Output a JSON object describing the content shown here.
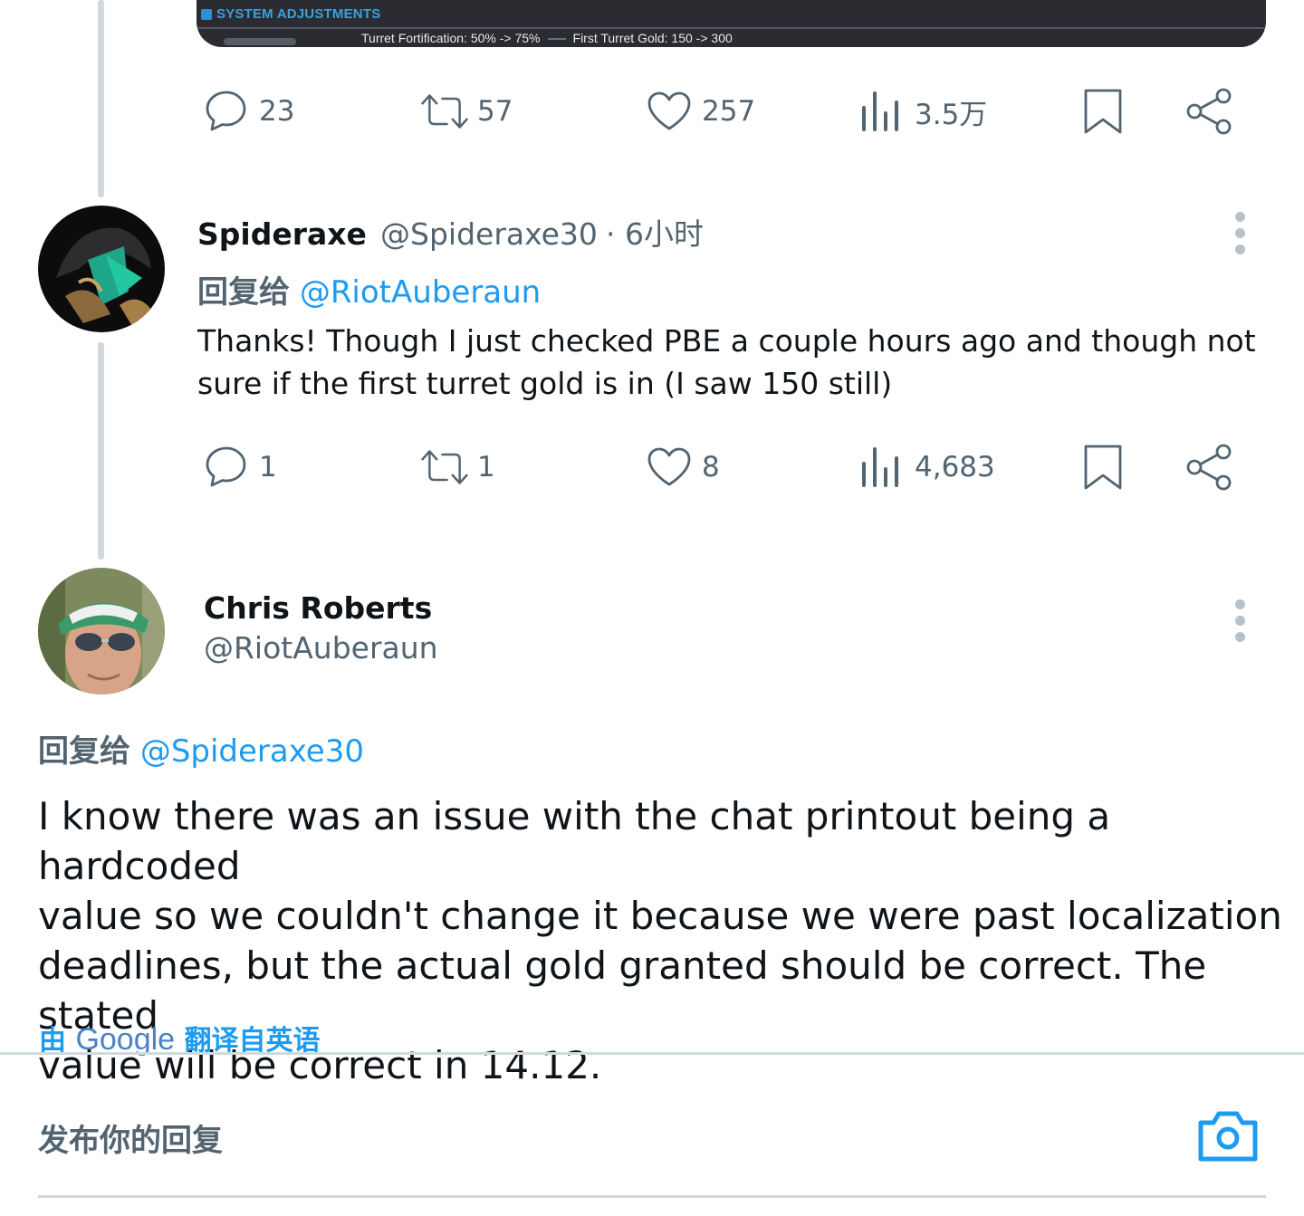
{
  "media": {
    "header": "SYSTEM ADJUSTMENTS",
    "line_a": "Turret Fortification: 50% -> 75%",
    "line_b": "First Turret Gold: 150 -> 300"
  },
  "tweet1_actions": {
    "replies": "23",
    "retweets": "57",
    "likes": "257",
    "views": "3.5万"
  },
  "reply1": {
    "name": "Spideraxe",
    "handle": "@Spideraxe30",
    "time": "· 6小时",
    "reply_prefix": "回复给",
    "reply_to": "@RiotAuberaun",
    "text_line1": "Thanks! Though I just checked PBE a couple hours ago and though not",
    "text_line2": "sure if the first turret gold is in (I saw 150 still)",
    "actions": {
      "replies": "1",
      "retweets": "1",
      "likes": "8",
      "views": "4,683"
    }
  },
  "main_tweet": {
    "name": "Chris Roberts",
    "handle": "@RiotAuberaun",
    "reply_prefix": "回复给",
    "reply_to": "@Spideraxe30",
    "text_line1": "I know there was an issue with the chat printout being a hardcoded",
    "text_line2": "value so we couldn't change it because we were past localization",
    "text_line3": "deadlines, but the actual gold granted should be correct. The stated",
    "text_line4": "value will be correct in 14.12.",
    "translate_prefix": "由",
    "translate_brand": "Google",
    "translate_suffix": "翻译自英语"
  },
  "composer": {
    "placeholder": "发布你的回复"
  },
  "colors": {
    "accent": "#1d9bf0",
    "secondary_text": "#536471",
    "divider": "#cfd9de"
  },
  "icons": [
    "reply-icon",
    "retweet-icon",
    "like-icon",
    "views-icon",
    "bookmark-icon",
    "share-icon",
    "more-icon",
    "camera-icon"
  ]
}
